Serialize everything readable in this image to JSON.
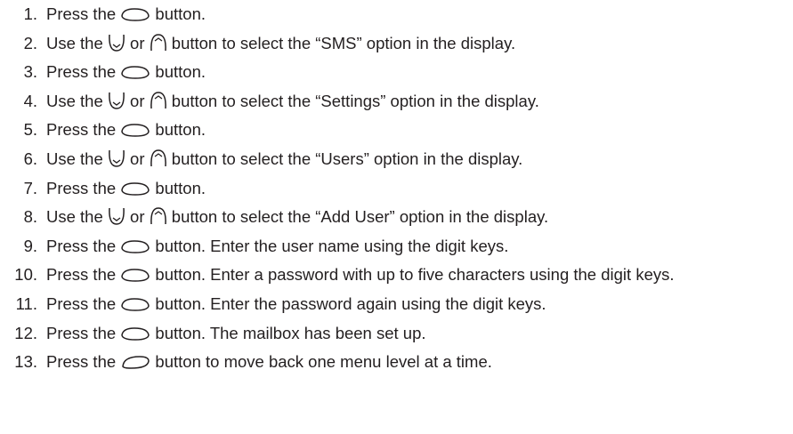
{
  "steps": [
    {
      "number": "1.",
      "parts": [
        {
          "t": "Press the "
        },
        {
          "icon": "ok-button-icon"
        },
        {
          "t": " button."
        }
      ]
    },
    {
      "number": "2.",
      "parts": [
        {
          "t": "Use the "
        },
        {
          "icon": "down-arrow-button-icon"
        },
        {
          "t": " or "
        },
        {
          "icon": "up-arrow-button-icon"
        },
        {
          "t": " button to select the “SMS” option in the display."
        }
      ]
    },
    {
      "number": "3.",
      "parts": [
        {
          "t": "Press the "
        },
        {
          "icon": "ok-button-icon"
        },
        {
          "t": " button."
        }
      ]
    },
    {
      "number": "4.",
      "parts": [
        {
          "t": "Use the "
        },
        {
          "icon": "down-arrow-button-icon"
        },
        {
          "t": " or "
        },
        {
          "icon": "up-arrow-button-icon"
        },
        {
          "t": " button to select the “Settings” option in the display."
        }
      ]
    },
    {
      "number": "5.",
      "parts": [
        {
          "t": "Press the "
        },
        {
          "icon": "ok-button-icon"
        },
        {
          "t": " button."
        }
      ]
    },
    {
      "number": "6.",
      "parts": [
        {
          "t": "Use the "
        },
        {
          "icon": "down-arrow-button-icon"
        },
        {
          "t": " or "
        },
        {
          "icon": "up-arrow-button-icon"
        },
        {
          "t": " button to select the “Users” option in the display."
        }
      ]
    },
    {
      "number": "7.",
      "parts": [
        {
          "t": "Press the "
        },
        {
          "icon": "ok-button-icon"
        },
        {
          "t": " button."
        }
      ]
    },
    {
      "number": "8.",
      "parts": [
        {
          "t": "Use the "
        },
        {
          "icon": "down-arrow-button-icon"
        },
        {
          "t": " or "
        },
        {
          "icon": "up-arrow-button-icon"
        },
        {
          "t": " button to select the “Add User” option in the display."
        }
      ]
    },
    {
      "number": "9.",
      "parts": [
        {
          "t": "Press the "
        },
        {
          "icon": "ok-button-icon"
        },
        {
          "t": " button. Enter the user name using the digit keys."
        }
      ]
    },
    {
      "number": "10.",
      "parts": [
        {
          "t": "Press the "
        },
        {
          "icon": "ok-button-icon"
        },
        {
          "t": " button. Enter a password with up to five characters using the digit keys."
        }
      ]
    },
    {
      "number": "11.",
      "parts": [
        {
          "t": "Press the "
        },
        {
          "icon": "ok-button-icon"
        },
        {
          "t": " button. Enter the password again using the digit keys."
        }
      ]
    },
    {
      "number": "12.",
      "parts": [
        {
          "t": "Press the "
        },
        {
          "icon": "ok-button-icon"
        },
        {
          "t": " button. The mailbox has been set up."
        }
      ]
    },
    {
      "number": "13.",
      "parts": [
        {
          "t": "Press the "
        },
        {
          "icon": "back-button-icon"
        },
        {
          "t": " button to move back one menu level at a time."
        }
      ]
    }
  ],
  "colors": {
    "text": "#231f20",
    "icon_stroke": "#231f20"
  }
}
